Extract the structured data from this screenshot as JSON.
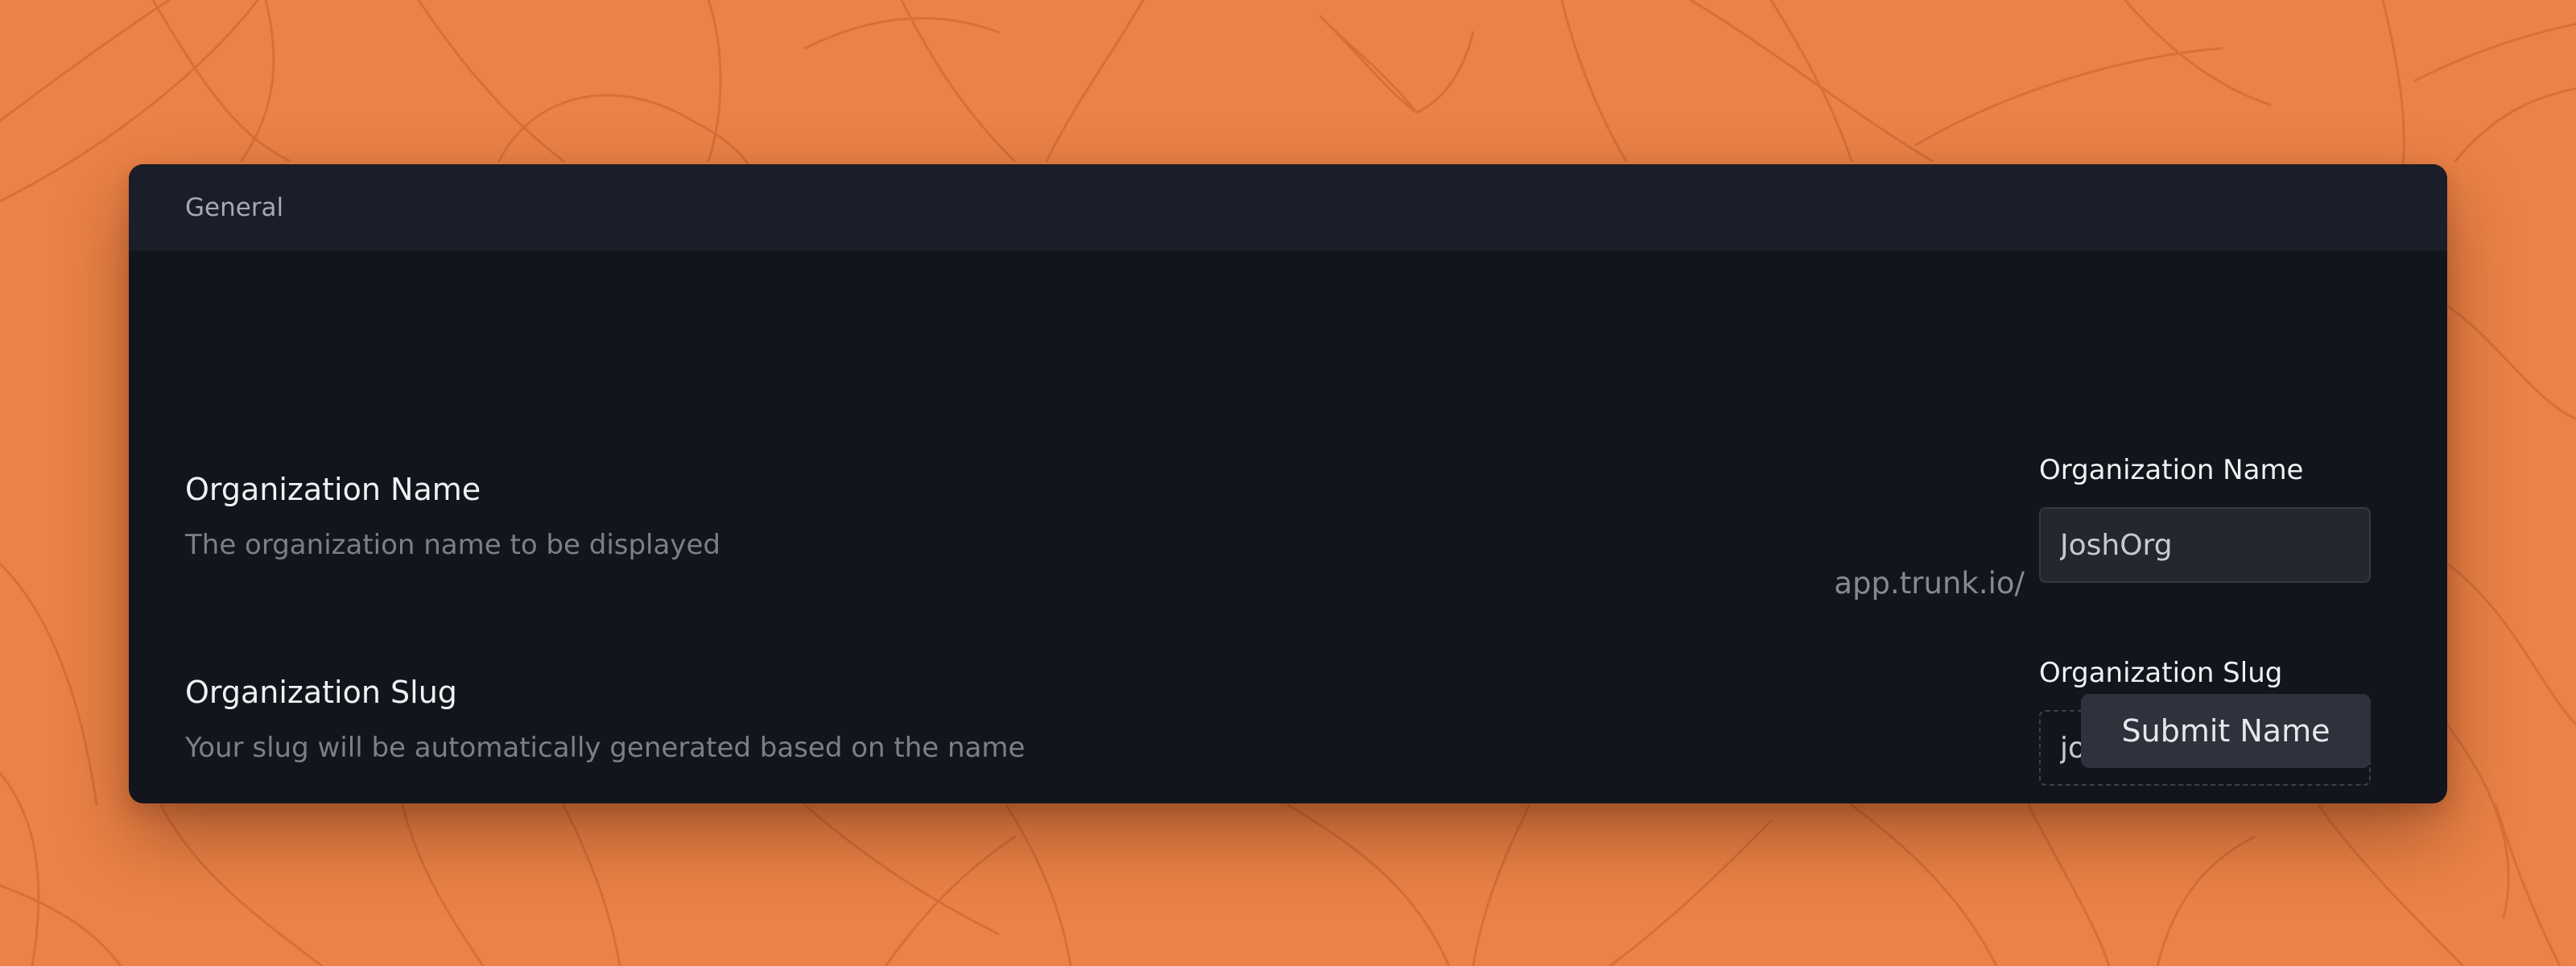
{
  "colors": {
    "page_background": "#ec8247",
    "card_background": "#13151c",
    "card_header_background": "#1b1d28",
    "button_background": "#2f323c"
  },
  "section": {
    "title": "General"
  },
  "org_name": {
    "title": "Organization Name",
    "description": "The organization name to be displayed",
    "field_label": "Organization Name",
    "value": "JoshOrg"
  },
  "org_slug": {
    "title": "Organization Slug",
    "description": "Your slug will be automatically generated based on the name",
    "field_label": "Organization Slug",
    "prefix": "app.trunk.io/",
    "value": "joshorg"
  },
  "actions": {
    "submit_label": "Submit Name"
  }
}
